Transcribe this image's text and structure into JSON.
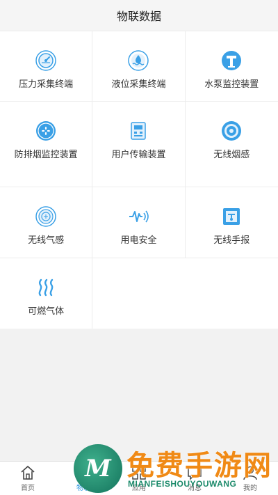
{
  "header": {
    "title": "物联数据"
  },
  "grid": [
    {
      "label": "压力采集终端",
      "icon": "pressure-gauge-icon"
    },
    {
      "label": "液位采集终端",
      "icon": "liquid-level-icon"
    },
    {
      "label": "水泵监控装置",
      "icon": "water-pump-icon"
    },
    {
      "label": "防排烟监控装置",
      "icon": "smoke-fan-icon"
    },
    {
      "label": "用户传输装置",
      "icon": "transmission-device-icon"
    },
    {
      "label": "无线烟感",
      "icon": "smoke-detector-icon"
    },
    {
      "label": "无线气感",
      "icon": "gas-sensor-icon"
    },
    {
      "label": "用电安全",
      "icon": "electric-wave-icon"
    },
    {
      "label": "无线手报",
      "icon": "manual-alarm-icon"
    },
    {
      "label": "可燃气体",
      "icon": "flammable-gas-icon"
    }
  ],
  "tabs": [
    {
      "label": "首页",
      "icon": "home-icon",
      "active": false
    },
    {
      "label": "物联",
      "icon": "iot-icon",
      "active": true
    },
    {
      "label": "应用",
      "icon": "apps-icon",
      "active": false
    },
    {
      "label": "消息",
      "icon": "message-icon",
      "active": false
    },
    {
      "label": "我的",
      "icon": "profile-icon",
      "active": false
    }
  ],
  "watermark": {
    "logo_letter": "M",
    "title": "免费手游网",
    "subtitle": "MIANFEISHOUYOUWANG"
  },
  "colors": {
    "accent": "#2a97e0",
    "icon_blue": "#3aa0e6",
    "watermark_orange": "#f08a16",
    "watermark_green": "#1b8a6a"
  }
}
